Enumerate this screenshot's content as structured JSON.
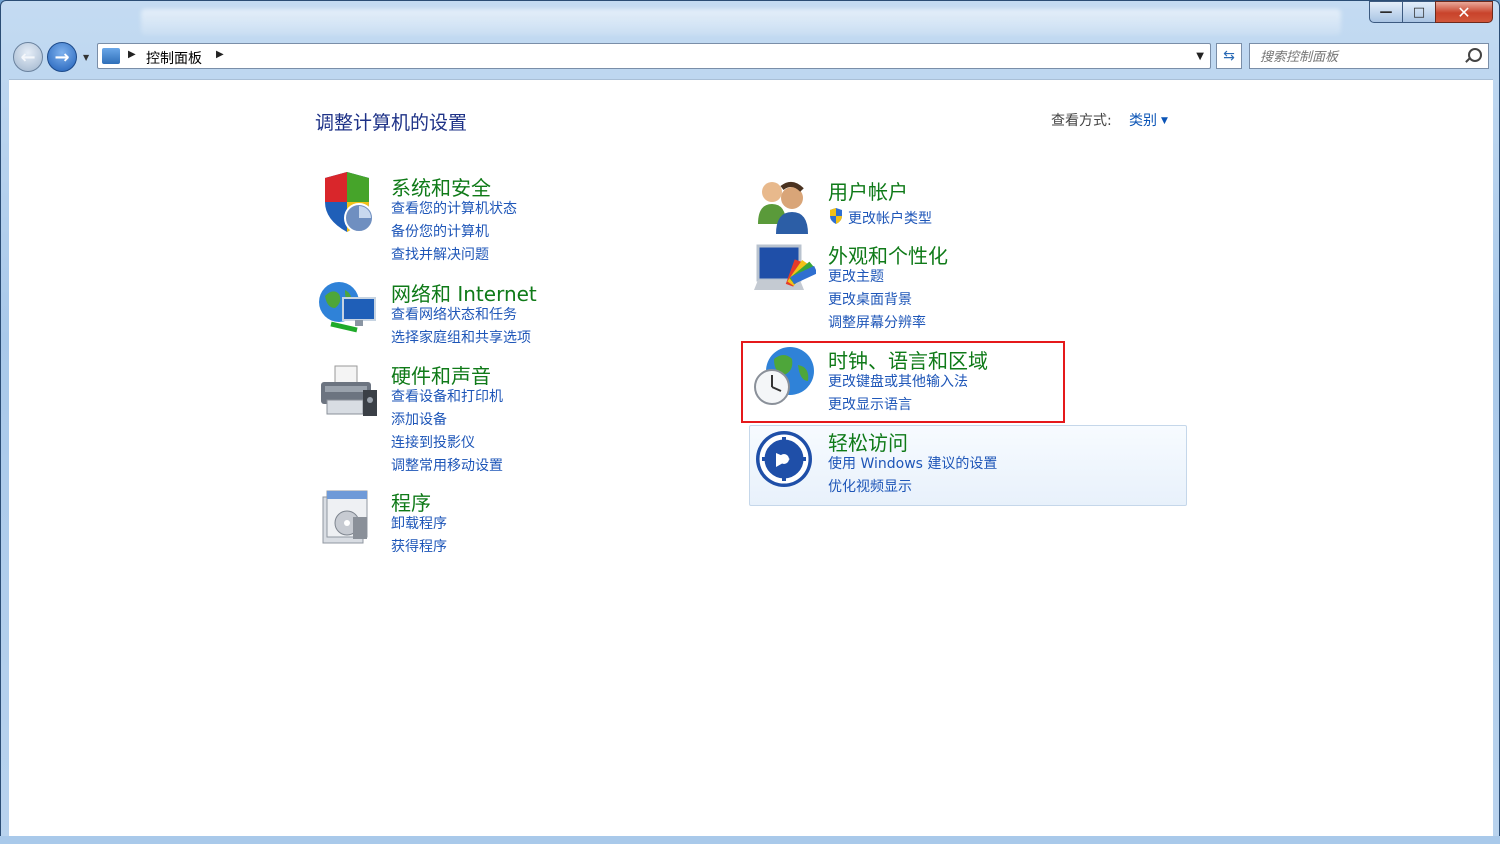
{
  "breadcrumb": {
    "root": "控制面板"
  },
  "search": {
    "placeholder": "搜索控制面板"
  },
  "page": {
    "title": "调整计算机的设置",
    "view_by_label": "查看方式:",
    "view_by_value": "类别"
  },
  "categories": [
    {
      "id": "system-security",
      "title": "系统和安全",
      "links": [
        "查看您的计算机状态",
        "备份您的计算机",
        "查找并解决问题"
      ]
    },
    {
      "id": "network",
      "title": "网络和 Internet",
      "links": [
        "查看网络状态和任务",
        "选择家庭组和共享选项"
      ]
    },
    {
      "id": "hardware-sound",
      "title": "硬件和声音",
      "links": [
        "查看设备和打印机",
        "添加设备",
        "连接到投影仪",
        "调整常用移动设置"
      ]
    },
    {
      "id": "programs",
      "title": "程序",
      "links": [
        "卸载程序",
        "获得程序"
      ]
    },
    {
      "id": "user-accounts",
      "title": "用户帐户",
      "links": [
        "更改帐户类型"
      ]
    },
    {
      "id": "appearance",
      "title": "外观和个性化",
      "links": [
        "更改主题",
        "更改桌面背景",
        "调整屏幕分辨率"
      ]
    },
    {
      "id": "clock-region",
      "title": "时钟、语言和区域",
      "links": [
        "更改键盘或其他输入法",
        "更改显示语言"
      ]
    },
    {
      "id": "ease-of-access",
      "title": "轻松访问",
      "links": [
        "使用 Windows 建议的设置",
        "优化视频显示"
      ]
    }
  ],
  "colors": {
    "category_title": "#0f7a18",
    "link": "#1e56b8",
    "page_title": "#1e3287",
    "highlight": "#e5191b"
  }
}
